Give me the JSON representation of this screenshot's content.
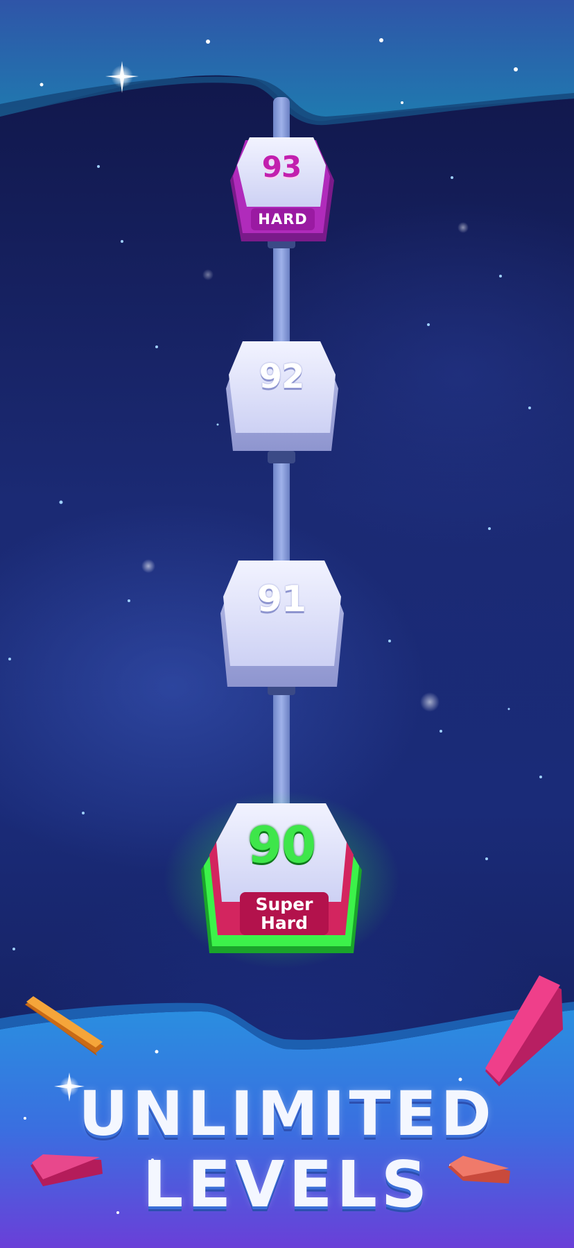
{
  "levels": [
    {
      "number": "93",
      "tag": "HARD",
      "number_color": "#c21fae",
      "state": "hard"
    },
    {
      "number": "92",
      "tag": "",
      "number_color": "#ffffff",
      "state": "locked"
    },
    {
      "number": "91",
      "tag": "",
      "number_color": "#ffffff",
      "state": "locked"
    },
    {
      "number": "90",
      "tag_line1": "Super",
      "tag_line2": "Hard",
      "number_color": "#3ee64a",
      "state": "current"
    }
  ],
  "banner": {
    "line1": "UNLIMITED",
    "line2": "LEVELS"
  },
  "colors": {
    "hard_accent": "#b01ea8",
    "super_hard_accent": "#c2185b",
    "current_glow": "#39ff4a",
    "tile_face": "#dfe2fb"
  }
}
